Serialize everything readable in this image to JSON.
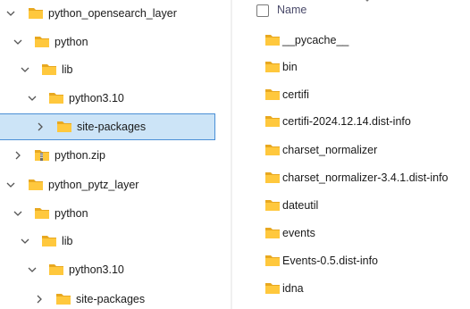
{
  "tree": [
    {
      "label": "python_opensearch_layer",
      "expanded": true,
      "selected": false
    },
    {
      "label": "python",
      "expanded": true,
      "selected": false
    },
    {
      "label": "lib",
      "expanded": true,
      "selected": false
    },
    {
      "label": "python3.10",
      "expanded": true,
      "selected": false
    },
    {
      "label": "site-packages",
      "expanded": false,
      "selected": true
    },
    {
      "label": "python.zip",
      "expanded": false,
      "selected": false
    },
    {
      "label": "python_pytz_layer",
      "expanded": true,
      "selected": false
    },
    {
      "label": "python",
      "expanded": true,
      "selected": false
    },
    {
      "label": "lib",
      "expanded": true,
      "selected": false
    },
    {
      "label": "python3.10",
      "expanded": true,
      "selected": false
    },
    {
      "label": "site-packages",
      "expanded": false,
      "selected": false
    }
  ],
  "content": {
    "column_name": "Name",
    "files": [
      {
        "label": "__pycache__"
      },
      {
        "label": "bin"
      },
      {
        "label": "certifi"
      },
      {
        "label": "certifi-2024.12.14.dist-info"
      },
      {
        "label": "charset_normalizer"
      },
      {
        "label": "charset_normalizer-3.4.1.dist-info"
      },
      {
        "label": "dateutil"
      },
      {
        "label": "events"
      },
      {
        "label": "Events-0.5.dist-info"
      },
      {
        "label": "idna"
      }
    ]
  },
  "colors": {
    "folder": "#ffc83d",
    "folder_dark": "#e8a820",
    "selection_bg": "#cce4f7",
    "selection_border": "#4a8fd6"
  }
}
